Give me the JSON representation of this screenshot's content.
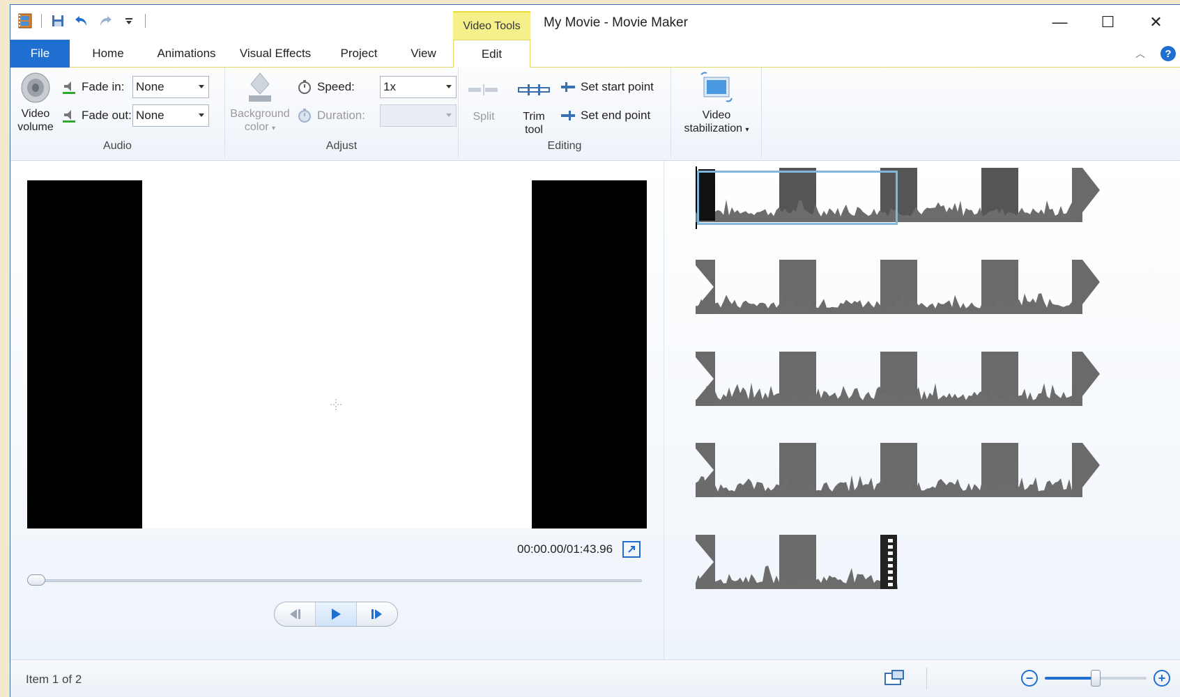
{
  "window": {
    "title": "My Movie - Movie Maker"
  },
  "context_tab": "Video Tools",
  "window_controls": {
    "minimize": "—",
    "maximize": "☐",
    "close": "✕"
  },
  "tabs": [
    {
      "label": "File"
    },
    {
      "label": "Home"
    },
    {
      "label": "Animations"
    },
    {
      "label": "Visual Effects"
    },
    {
      "label": "Project"
    },
    {
      "label": "View"
    },
    {
      "label": "Edit"
    }
  ],
  "ribbon": {
    "audio": {
      "group_label": "Audio",
      "video_volume_line1": "Video",
      "video_volume_line2": "volume",
      "fade_in_label": "Fade in:",
      "fade_in_value": "None",
      "fade_out_label": "Fade out:",
      "fade_out_value": "None"
    },
    "adjust": {
      "group_label": "Adjust",
      "background_line1": "Background",
      "background_line2": "color",
      "speed_label": "Speed:",
      "speed_value": "1x",
      "duration_label": "Duration:",
      "duration_value": ""
    },
    "editing": {
      "group_label": "Editing",
      "split_label": "Split",
      "trim_line1": "Trim",
      "trim_line2": "tool",
      "set_start": "Set start point",
      "set_end": "Set end point"
    },
    "stabilization": {
      "line1": "Video",
      "line2": "stabilization"
    }
  },
  "preview": {
    "time": "00:00.00/01:43.96"
  },
  "status": {
    "item_text": "Item 1 of 2",
    "zoom_minus": "−",
    "zoom_plus": "+",
    "zoom_level": 0.5
  },
  "colors": {
    "accent": "#1e6fd0",
    "context_tab": "#f5f08a",
    "selection": "#7fb8dc"
  }
}
